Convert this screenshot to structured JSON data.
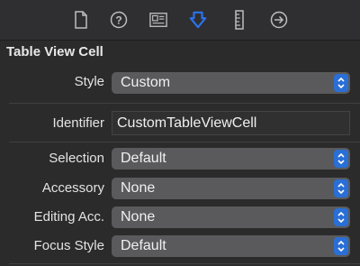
{
  "toolbar": {
    "icons": [
      "file-icon",
      "help-icon",
      "identity-icon",
      "attributes-icon",
      "size-icon",
      "connections-icon"
    ],
    "accent": "#2a73ee",
    "selected": "attributes-icon"
  },
  "section": {
    "title": "Table View Cell"
  },
  "fields": {
    "style": {
      "label": "Style",
      "value": "Custom"
    },
    "identifier": {
      "label": "Identifier",
      "value": "CustomTableViewCell"
    },
    "selection": {
      "label": "Selection",
      "value": "Default"
    },
    "accessory": {
      "label": "Accessory",
      "value": "None"
    },
    "editing_acc": {
      "label": "Editing Acc.",
      "value": "None"
    },
    "focus_style": {
      "label": "Focus Style",
      "value": "Default"
    }
  },
  "colors": {
    "stepper": "#2a6fd6",
    "background": "#2b2b2c",
    "popup": "#5a5a5c"
  }
}
